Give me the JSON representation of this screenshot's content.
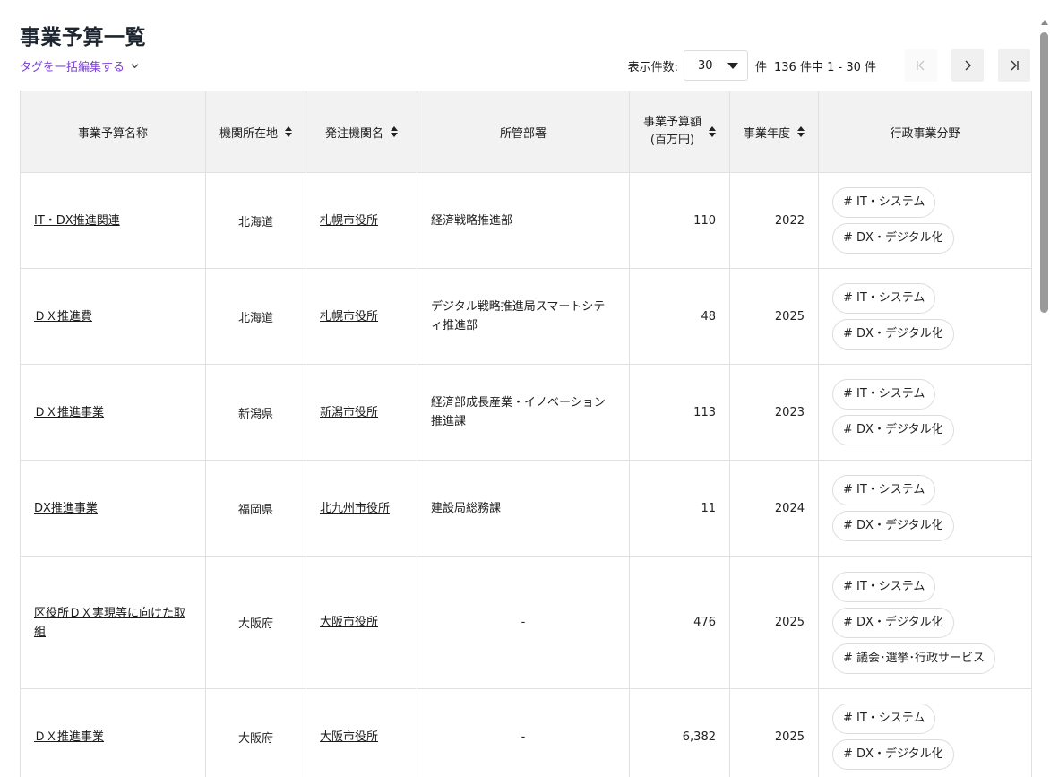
{
  "page": {
    "title": "事業予算一覧"
  },
  "bulk_edit": {
    "label": "タグを一括編集する"
  },
  "pager": {
    "per_page_label": "表示件数:",
    "per_page_value": "30",
    "unit": "件",
    "range": "136 件中  1 - 30 件"
  },
  "table": {
    "headers": {
      "name": "事業予算名称",
      "location": "機関所在地",
      "org": "発注機関名",
      "dept": "所管部署",
      "amount_line1": "事業予算額",
      "amount_line2": "(百万円)",
      "year": "事業年度",
      "field": "行政事業分野"
    },
    "rows": [
      {
        "name": "IT・DX推進関連",
        "location": "北海道",
        "org": "札幌市役所",
        "dept": "経済戦略推進部",
        "amount": "110",
        "year": "2022",
        "tags": [
          "# IT・システム",
          "# DX・デジタル化"
        ]
      },
      {
        "name": "ＤＸ推進費",
        "location": "北海道",
        "org": "札幌市役所",
        "dept": "デジタル戦略推進局スマートシティ推進部",
        "amount": "48",
        "year": "2025",
        "tags": [
          "# IT・システム",
          "# DX・デジタル化"
        ]
      },
      {
        "name": "ＤＸ推進事業",
        "location": "新潟県",
        "org": "新潟市役所",
        "dept": "経済部成長産業・イノベーション推進課",
        "amount": "113",
        "year": "2023",
        "tags": [
          "# IT・システム",
          "# DX・デジタル化"
        ]
      },
      {
        "name": "DX推進事業",
        "location": "福岡県",
        "org": "北九州市役所",
        "dept": "建設局総務課",
        "amount": "11",
        "year": "2024",
        "tags": [
          "# IT・システム",
          "# DX・デジタル化"
        ]
      },
      {
        "name": "区役所ＤＸ実現等に向けた取組",
        "location": "大阪府",
        "org": "大阪市役所",
        "dept": "-",
        "amount": "476",
        "year": "2025",
        "tags": [
          "# IT・システム",
          "# DX・デジタル化",
          "# 議会･選挙･行政サービス"
        ]
      },
      {
        "name": "ＤＸ推進事業",
        "location": "大阪府",
        "org": "大阪市役所",
        "dept": "-",
        "amount": "6,382",
        "year": "2025",
        "tags": [
          "# IT・システム",
          "# DX・デジタル化"
        ]
      }
    ]
  },
  "icons": {
    "bulk_edit": "chevron-down-icon",
    "first": "first-page-icon",
    "prev": "chevron-left-icon",
    "next": "chevron-right-icon",
    "last": "last-page-icon"
  }
}
